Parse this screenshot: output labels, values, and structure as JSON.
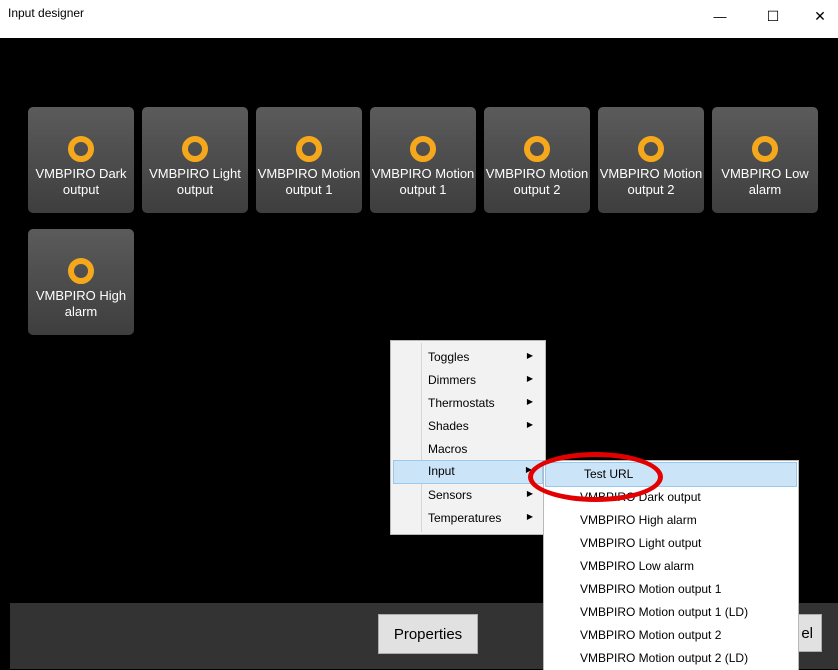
{
  "window": {
    "title": "Input designer",
    "minimize": "—",
    "maximize": "☐",
    "close": "✕"
  },
  "tiles": [
    {
      "label": "VMBPIRO Dark output"
    },
    {
      "label": "VMBPIRO Light output"
    },
    {
      "label": "VMBPIRO Motion output 1"
    },
    {
      "label": "VMBPIRO Motion output 1"
    },
    {
      "label": "VMBPIRO Motion output 2"
    },
    {
      "label": "VMBPIRO Motion output 2"
    },
    {
      "label": "VMBPIRO Low alarm"
    },
    {
      "label": "VMBPIRO High alarm"
    }
  ],
  "footer": {
    "properties_label": "Properties",
    "cancel_label": "el"
  },
  "context_menu": {
    "items": [
      {
        "label": "Toggles",
        "has_submenu": true
      },
      {
        "label": "Dimmers",
        "has_submenu": true
      },
      {
        "label": "Thermostats",
        "has_submenu": true
      },
      {
        "label": "Shades",
        "has_submenu": true
      },
      {
        "label": "Macros",
        "has_submenu": false
      },
      {
        "label": "Input",
        "has_submenu": true,
        "selected": true
      },
      {
        "label": "Sensors",
        "has_submenu": true
      },
      {
        "label": "Temperatures",
        "has_submenu": true
      }
    ],
    "arrow": "▶"
  },
  "submenu": {
    "items": [
      {
        "label": "Test URL",
        "selected": true
      },
      {
        "label": "VMBPIRO Dark output"
      },
      {
        "label": "VMBPIRO High alarm"
      },
      {
        "label": "VMBPIRO Light output"
      },
      {
        "label": "VMBPIRO Low alarm"
      },
      {
        "label": "VMBPIRO Motion output 1"
      },
      {
        "label": "VMBPIRO Motion output 1 (LD)"
      },
      {
        "label": "VMBPIRO Motion output 2"
      },
      {
        "label": "VMBPIRO Motion output 2 (LD)"
      }
    ]
  },
  "colors": {
    "background": "#000000",
    "tile": "#4a4a4a",
    "ring": "#f5a81c",
    "highlight": "#cce4f7",
    "annotation": "#e20000"
  }
}
